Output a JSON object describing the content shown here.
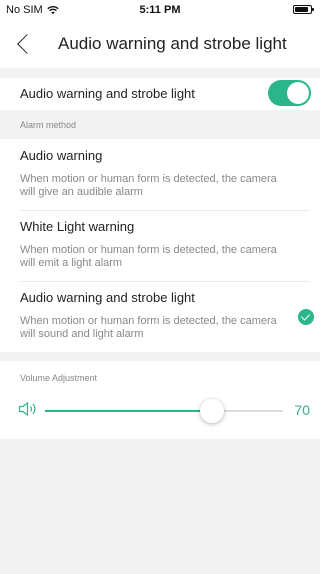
{
  "status_bar": {
    "carrier": "No SIM",
    "time": "5:11 PM"
  },
  "nav": {
    "title": "Audio warning and strobe light"
  },
  "main_toggle": {
    "label": "Audio warning and strobe light",
    "enabled": true
  },
  "alarm_method": {
    "header": "Alarm method",
    "options": [
      {
        "title": "Audio warning",
        "description": "When motion or human form is detected, the camera will give an audible alarm",
        "selected": false
      },
      {
        "title": "White Light warning",
        "description": "When motion or human form is detected, the camera will emit a light alarm",
        "selected": false
      },
      {
        "title": "Audio warning and strobe light",
        "description": "When motion or human form is detected, the camera will sound and light alarm",
        "selected": true
      }
    ]
  },
  "volume": {
    "label": "Volume Adjustment",
    "value": "70",
    "fraction": 0.7
  },
  "colors": {
    "accent": "#2bb58a",
    "background": "#f2f2f2"
  }
}
